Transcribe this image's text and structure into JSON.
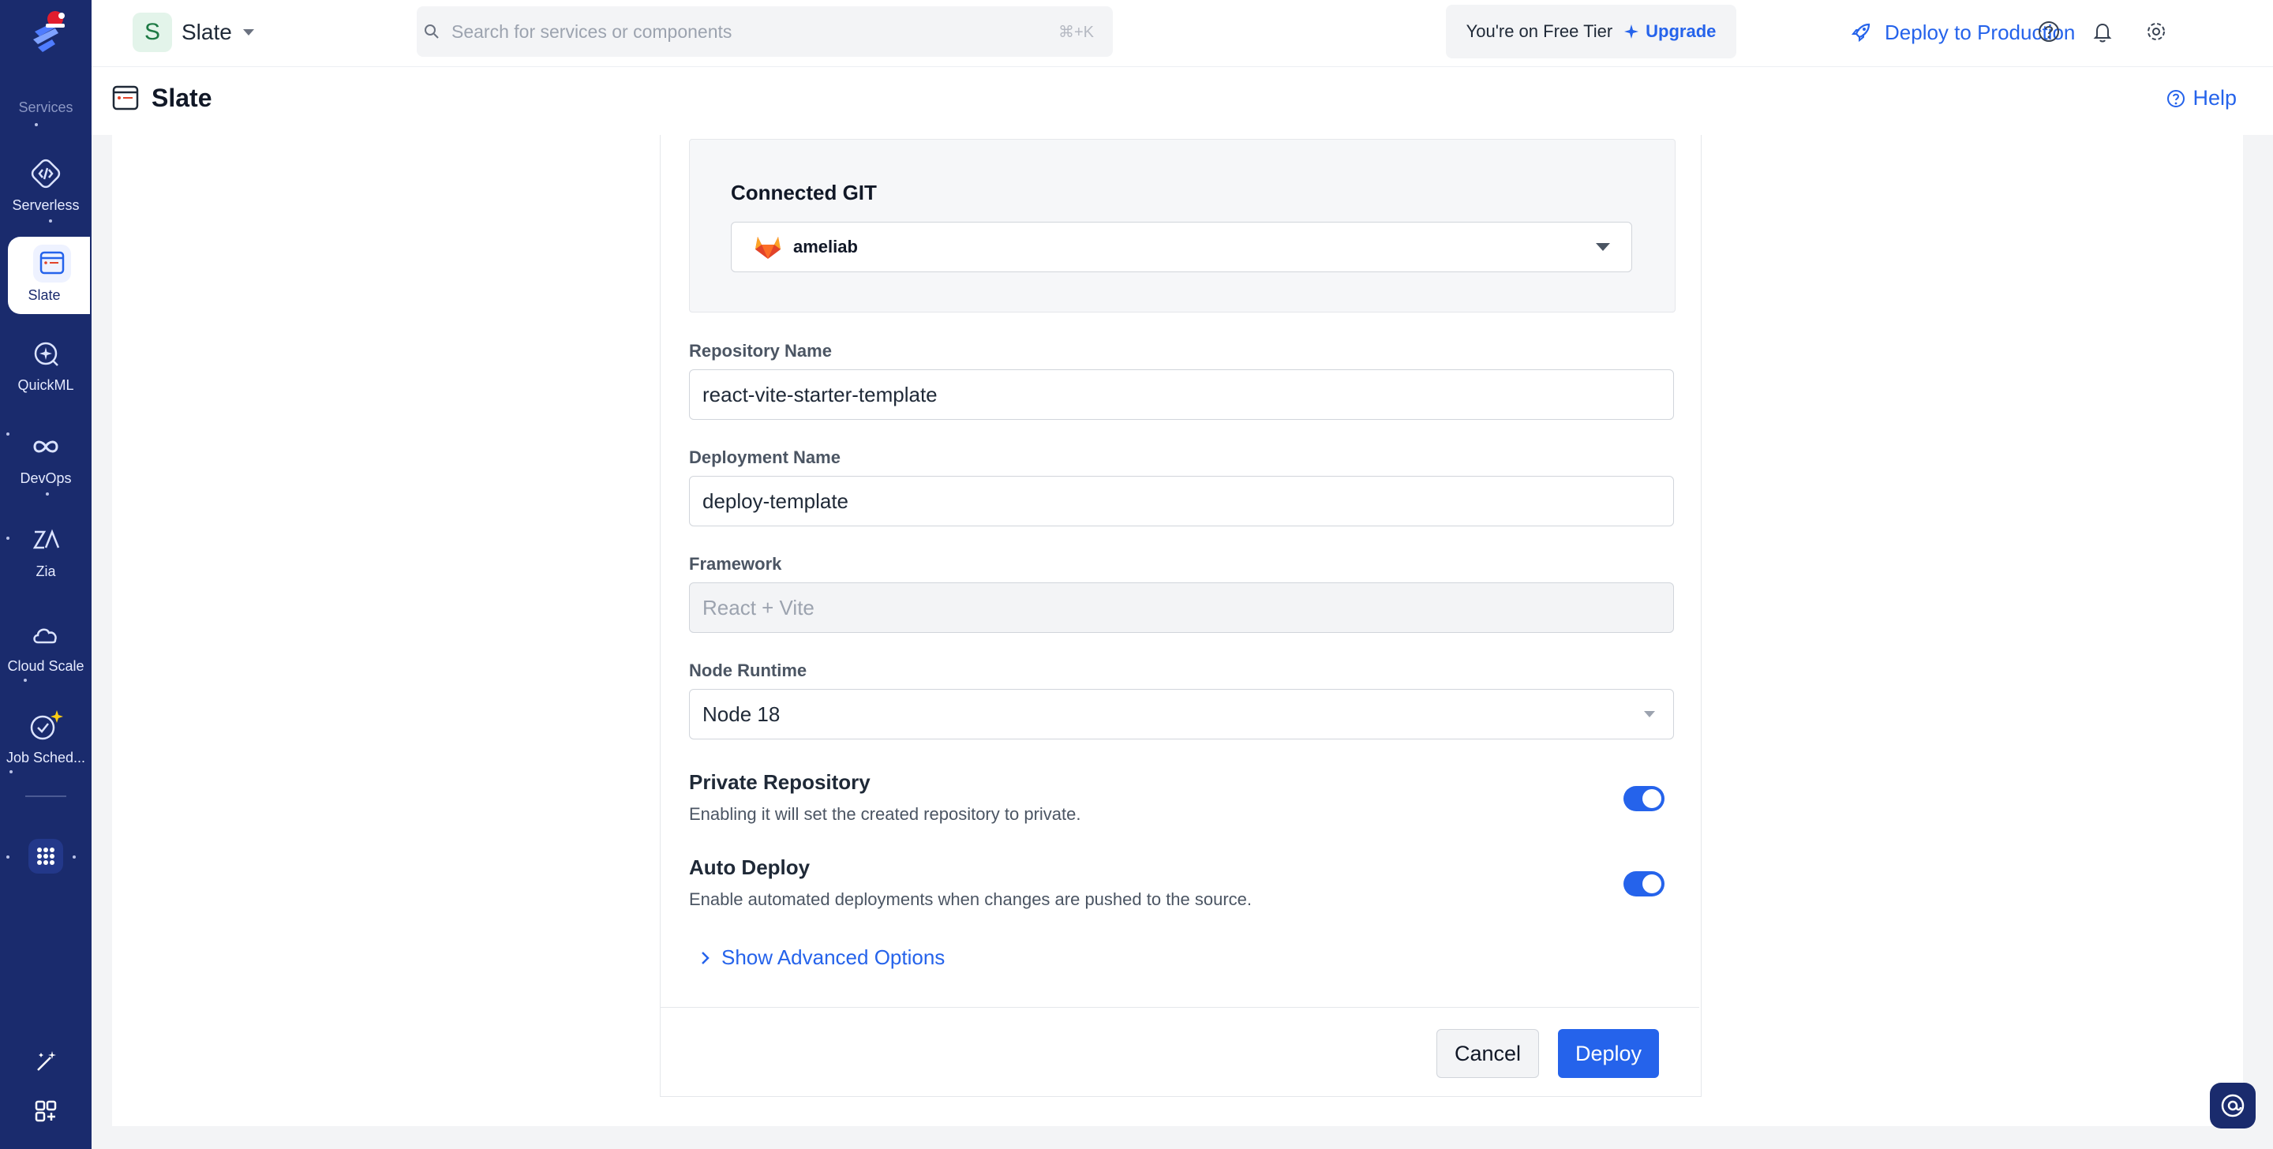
{
  "rail": {
    "section_title": "Services",
    "items": [
      {
        "label": "Serverless"
      },
      {
        "label": "Slate"
      },
      {
        "label": "QuickML"
      },
      {
        "label": "DevOps"
      },
      {
        "label": "Zia"
      },
      {
        "label": "Cloud Scale"
      },
      {
        "label": "Job Sched..."
      }
    ]
  },
  "topbar": {
    "project_initial": "S",
    "project_name": "Slate",
    "search_placeholder": "Search for services or components",
    "search_shortcut": "⌘+K",
    "tier_text": "You're on Free Tier",
    "upgrade_label": "Upgrade",
    "deploy_prod_label": "Deploy to Production"
  },
  "page": {
    "title": "Slate",
    "help_label": "Help"
  },
  "form": {
    "connected_git_label": "Connected GIT",
    "connected_git_value": "ameliab",
    "repo_name_label": "Repository Name",
    "repo_name_value": "react-vite-starter-template",
    "deployment_name_label": "Deployment Name",
    "deployment_name_value": "deploy-template",
    "framework_label": "Framework",
    "framework_value": "React + Vite",
    "node_runtime_label": "Node Runtime",
    "node_runtime_value": "Node 18",
    "private_repo_title": "Private Repository",
    "private_repo_desc": "Enabling it will set the created repository to private.",
    "private_repo_on": true,
    "auto_deploy_title": "Auto Deploy",
    "auto_deploy_desc": "Enable automated deployments when changes are pushed to the source.",
    "auto_deploy_on": true,
    "advanced_label": "Show Advanced Options",
    "cancel_label": "Cancel",
    "deploy_label": "Deploy"
  },
  "colors": {
    "rail_bg": "#1a2b6d",
    "accent": "#2563eb",
    "gitlab_orange": "#e24329"
  }
}
